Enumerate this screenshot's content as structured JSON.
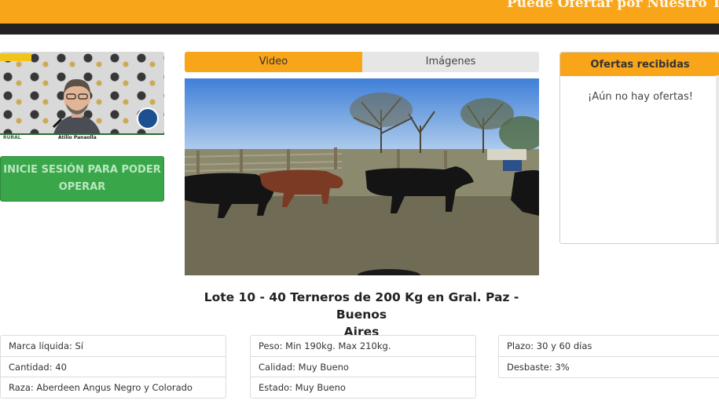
{
  "header": {
    "marquee_text": "Puede Ofertar por Nuestro Tel"
  },
  "stream": {
    "presenter_name": "Atilio Panaolla",
    "brand": "RURAL"
  },
  "login_button": {
    "line1": "INICIE SESIÓN PARA PODER",
    "line2": "OPERAR"
  },
  "media_tabs": {
    "video": "Video",
    "images": "Imágenes",
    "active": "video"
  },
  "lot": {
    "title_line1": "Lote 10 - 40 Terneros de 200 Kg en Gral. Paz - Buenos",
    "title_line2": "Aires"
  },
  "offers": {
    "title": "Ofertas recibidas",
    "empty_message": "¡Aún no hay ofertas!"
  },
  "details": {
    "col1": [
      "Marca líquida: Sí",
      "Cantidad: 40",
      "Raza: Aberdeen Angus Negro y Colorado"
    ],
    "col2": [
      "Peso: Min 190kg. Max 210kg.",
      "Calidad: Muy Bueno",
      "Estado: Muy Bueno"
    ],
    "col3": [
      "Plazo: 30 y 60 días",
      "Desbaste: 3%"
    ]
  },
  "colors": {
    "accent": "#f9a51a",
    "login_green": "#3aa64a",
    "dark_bar": "#222222"
  },
  "icons": {
    "stream_badge": "circle-badge-icon"
  }
}
